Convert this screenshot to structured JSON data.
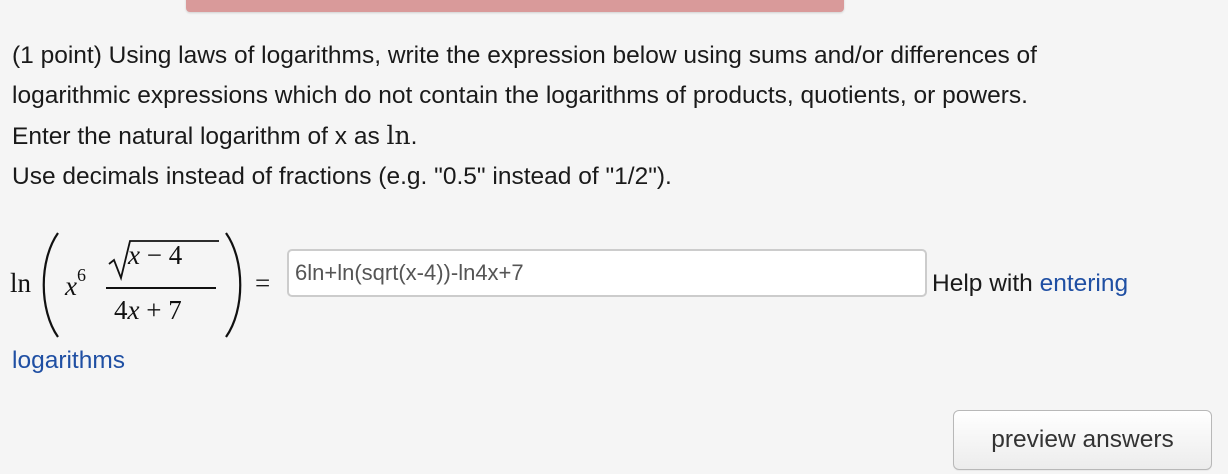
{
  "problem": {
    "line1": "(1 point) Using laws of logarithms, write the expression below using sums and/or differences of",
    "line2": "logarithmic expressions which do not contain the logarithms of products, quotients, or powers.",
    "line3_prefix": "Enter the natural logarithm of x as ",
    "line3_math": "ln",
    "line3_suffix": ".",
    "line4": "Use decimals instead of fractions (e.g. \"0.5\" instead of \"1/2\")."
  },
  "expression": {
    "ln": "ln",
    "base": "x",
    "exponent": "6",
    "numerator_var": "x",
    "numerator_rest": " − 4",
    "denominator_coef": "4",
    "denominator_var": "x",
    "denominator_rest": " + 7",
    "equals": "="
  },
  "answer": {
    "value": "6ln+ln(sqrt(x-4))-ln4x+7"
  },
  "help": {
    "prefix": "Help with ",
    "link_part1": "entering",
    "link_part2": "logarithms"
  },
  "buttons": {
    "preview_label": "preview answers"
  },
  "colors": {
    "link": "#1f4fa3",
    "top_bar": "#d99a9a",
    "background": "#f5f5f5"
  }
}
